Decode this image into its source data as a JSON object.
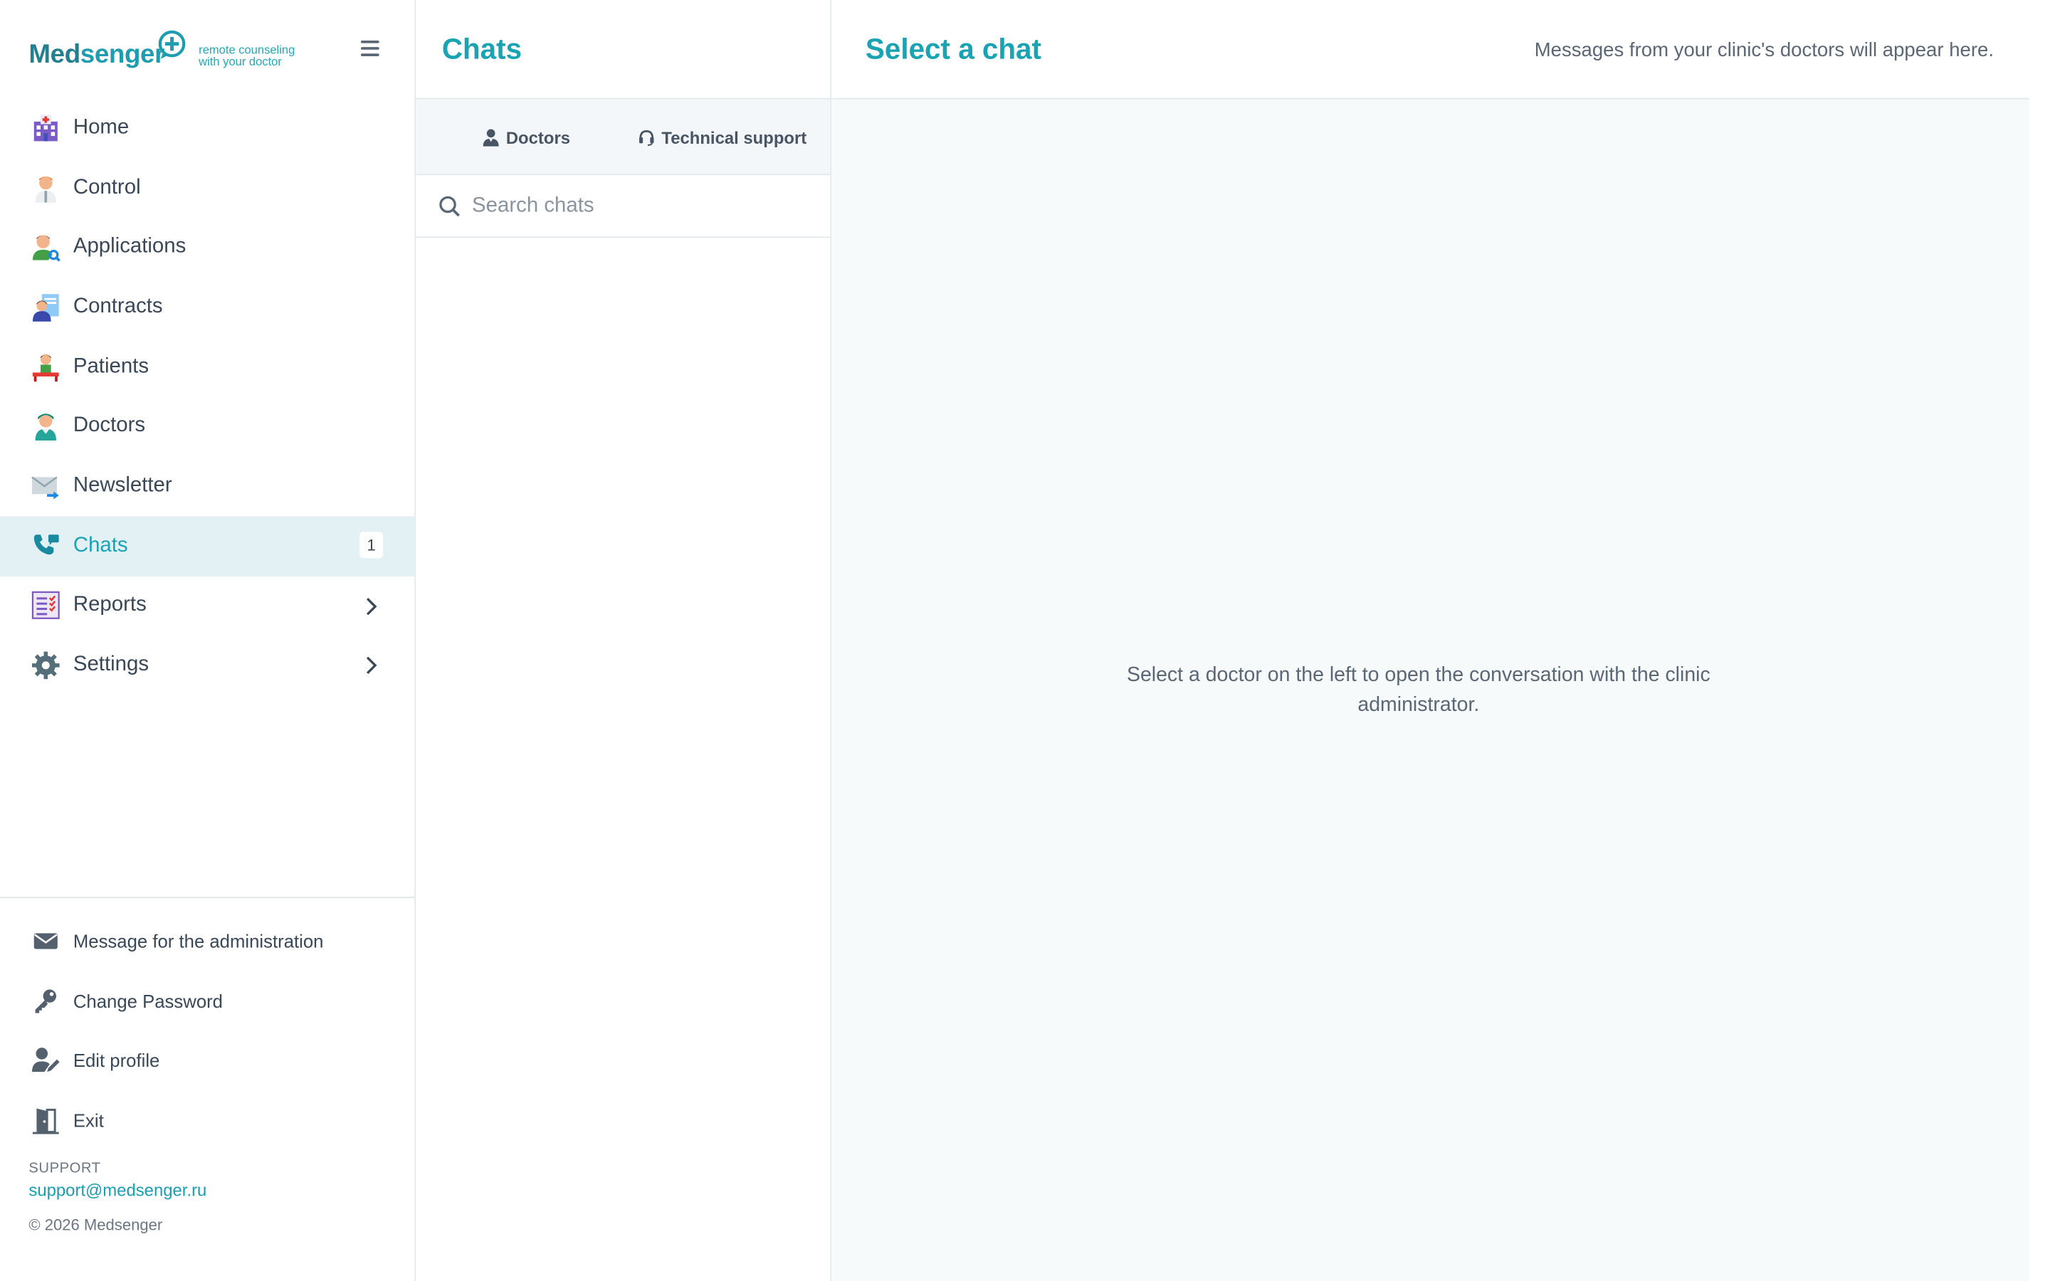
{
  "brand": {
    "name_part1": "Med",
    "name_part2": "senger",
    "tagline_line1": "remote counseling",
    "tagline_line2": "with your doctor",
    "accent": "#1aa3b3"
  },
  "sidebar": {
    "items": [
      {
        "label": "Home",
        "icon": "hospital-icon"
      },
      {
        "label": "Control",
        "icon": "doctor-icon"
      },
      {
        "label": "Applications",
        "icon": "user-search-icon"
      },
      {
        "label": "Contracts",
        "icon": "contract-icon"
      },
      {
        "label": "Patients",
        "icon": "patient-icon"
      },
      {
        "label": "Doctors",
        "icon": "nurse-icon"
      },
      {
        "label": "Newsletter",
        "icon": "envelope-send-icon"
      },
      {
        "label": "Chats",
        "icon": "phone-chat-icon",
        "badge": "1",
        "active": true
      },
      {
        "label": "Reports",
        "icon": "report-list-icon",
        "has_submenu": true
      },
      {
        "label": "Settings",
        "icon": "gear-icon",
        "has_submenu": true
      }
    ],
    "bottom_links": [
      {
        "label": "Message for the administration",
        "icon": "envelope-icon"
      },
      {
        "label": "Change Password",
        "icon": "key-icon"
      },
      {
        "label": "Edit profile",
        "icon": "user-edit-icon"
      },
      {
        "label": "Exit",
        "icon": "door-exit-icon"
      }
    ],
    "support_label": "SUPPORT",
    "support_email": "support@medsenger.ru",
    "copyright": "© 2026 Medsenger"
  },
  "chatlist": {
    "title": "Chats",
    "tabs": [
      {
        "label": "Doctors",
        "icon": "user-icon"
      },
      {
        "label": "Technical support",
        "icon": "headset-icon"
      }
    ],
    "search_placeholder": "Search chats",
    "search_value": ""
  },
  "main": {
    "title": "Select a chat",
    "subtitle": "Messages from your clinic's doctors will appear here.",
    "empty_message": "Select a doctor on the left to open the conversation with the clinic administrator."
  }
}
